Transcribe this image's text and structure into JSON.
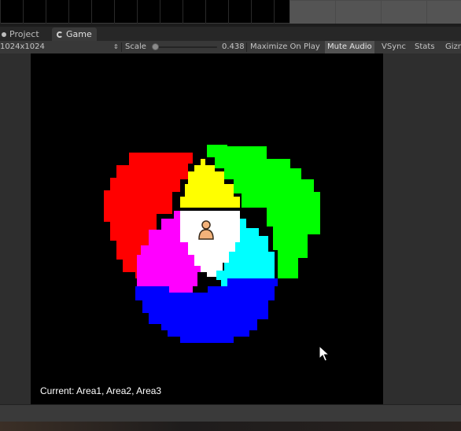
{
  "tabs": [
    {
      "label": "Project",
      "icon": "project-tab-icon"
    },
    {
      "label": "Game",
      "icon": "game-tab-icon"
    }
  ],
  "toolbar": {
    "resolution": "1024x1024",
    "scale_label": "Scale",
    "scale_value": "0.438",
    "scale_fraction": 0.0,
    "maximize_on_play": "Maximize On Play",
    "mute_audio": "Mute Audio",
    "mute_audio_active": true,
    "vsync": "VSync",
    "stats": "Stats",
    "gizmos": "Gizmos"
  },
  "game": {
    "status": "Current: Area1, Area2, Area3",
    "areas": [
      {
        "name": "red",
        "color": "#ff0000"
      },
      {
        "name": "green",
        "color": "#00ff00"
      },
      {
        "name": "blue",
        "color": "#0000ff"
      },
      {
        "name": "yellow",
        "color": "#ffff00"
      },
      {
        "name": "magenta",
        "color": "#ff00ff"
      },
      {
        "name": "cyan",
        "color": "#00ffff"
      },
      {
        "name": "white",
        "color": "#ffffff"
      }
    ],
    "player_icon": "person-icon"
  },
  "colors": {
    "panel": "#383838",
    "canvas": "#000000",
    "text": "#c4c4c4"
  }
}
